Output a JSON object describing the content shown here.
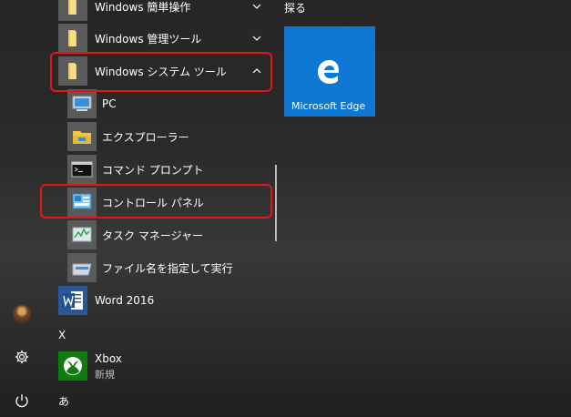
{
  "app_list": {
    "items": [
      {
        "label": "Windows 簡単操作",
        "icon": "folder-icon",
        "expanded": false
      },
      {
        "label": "Windows 管理ツール",
        "icon": "folder-icon",
        "expanded": false
      },
      {
        "label": "Windows システム ツール",
        "icon": "folder-icon",
        "expanded": true,
        "children": [
          {
            "label": "PC",
            "icon": "pc-icon"
          },
          {
            "label": "エクスプローラー",
            "icon": "file-explorer-icon"
          },
          {
            "label": "コマンド プロンプト",
            "icon": "command-prompt-icon"
          },
          {
            "label": "コントロール パネル",
            "icon": "control-panel-icon"
          },
          {
            "label": "タスク マネージャー",
            "icon": "task-manager-icon"
          },
          {
            "label": "ファイル名を指定して実行",
            "icon": "run-icon"
          }
        ]
      },
      {
        "label": "Word 2016",
        "icon": "word-icon"
      }
    ],
    "section_x": "X",
    "xbox": {
      "label": "Xbox",
      "sublabel": "新規",
      "icon": "xbox-icon"
    },
    "section_a": "あ"
  },
  "tiles": {
    "group_title": "探る",
    "items": [
      {
        "label": "Microsoft Edge",
        "icon": "edge-icon",
        "color": "#0f78d4"
      }
    ]
  },
  "rail": {
    "items": [
      "user-avatar",
      "settings-icon",
      "power-icon"
    ]
  },
  "highlight_color": "#e8141b"
}
